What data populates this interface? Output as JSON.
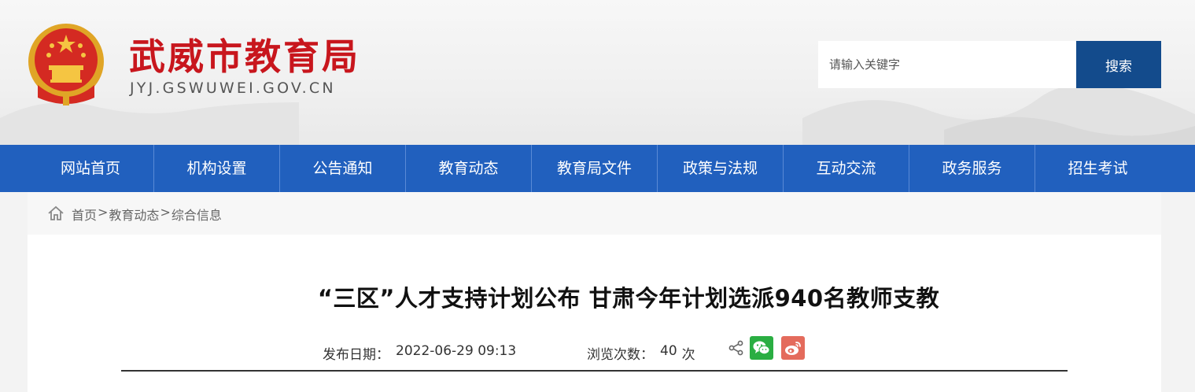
{
  "header": {
    "site_title": "武威市教育局",
    "site_domain": "JYJ.GSWUWEI.GOV.CN",
    "search_placeholder": "请输入关键字",
    "search_button": "搜索",
    "emblem_icon": "national-emblem-icon"
  },
  "nav": {
    "items": [
      {
        "label": "网站首页"
      },
      {
        "label": "机构设置"
      },
      {
        "label": "公告通知"
      },
      {
        "label": "教育动态"
      },
      {
        "label": "教育局文件"
      },
      {
        "label": "政策与法规"
      },
      {
        "label": "互动交流"
      },
      {
        "label": "政务服务"
      },
      {
        "label": "招生考试"
      }
    ]
  },
  "breadcrumb": {
    "icon": "home-icon",
    "items": [
      "首页",
      "教育动态",
      "综合信息"
    ],
    "separator": ">"
  },
  "article": {
    "title": "“三区”人才支持计划公布 甘肃今年计划选派940名教师支教",
    "date_label": "发布日期：",
    "date_value": "2022-06-29 09:13",
    "views_label": "浏览次数：",
    "views_value": "40",
    "views_unit": "次"
  },
  "share": {
    "icons": [
      "share-icon",
      "wechat-icon",
      "weibo-icon"
    ]
  },
  "colors": {
    "brand_red": "#c8161d",
    "nav_blue": "#2160be",
    "search_button": "#134b8c",
    "wechat_green": "#2aae42",
    "weibo_red": "#e46b5c"
  }
}
